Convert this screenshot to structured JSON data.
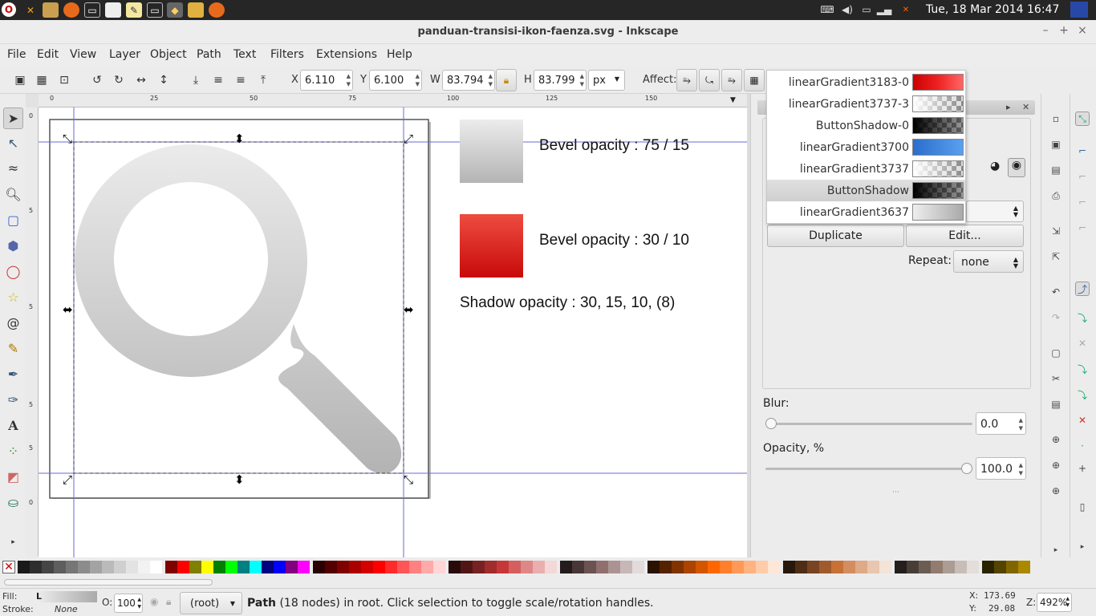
{
  "system": {
    "clock": "Tue, 18 Mar 2014 16:47",
    "tray_icons": [
      "keyboard-icon",
      "volume-icon",
      "battery-icon",
      "signal-icon",
      "network-icon"
    ],
    "launcher_icons": [
      "app-menu-icon",
      "tools-icon",
      "files-icon",
      "firefox-icon",
      "terminal-icon",
      "window-icon",
      "notes-icon",
      "terminal2-icon",
      "inkscape-icon",
      "folder-icon",
      "firefox2-icon"
    ]
  },
  "window": {
    "title": "panduan-transisi-ikon-faenza.svg - Inkscape",
    "minimize": "–",
    "maximize": "+",
    "close": "×"
  },
  "menu": [
    "File",
    "Edit",
    "View",
    "Layer",
    "Object",
    "Path",
    "Text",
    "Filters",
    "Extensions",
    "Help"
  ],
  "toolbar": {
    "x_label": "X",
    "x_value": "6.110",
    "y_label": "Y",
    "y_value": "6.100",
    "w_label": "W",
    "w_value": "83.794",
    "h_label": "H",
    "h_value": "83.799",
    "unit": "px",
    "affect_label": "Affect:"
  },
  "ruler": {
    "h_ticks": [
      "0",
      "25",
      "50",
      "75",
      "100",
      "125",
      "150"
    ],
    "v_ticks": [
      "0",
      "5",
      "5",
      "5",
      "5",
      "0"
    ]
  },
  "canvas": {
    "labels": [
      "Bevel opacity : 75 / 15",
      "Bevel opacity : 30 / 10",
      "Shadow opacity : 30, 15, 10, (8)"
    ],
    "colors": {
      "bevel1_top": "#ececec",
      "bevel1_bottom": "#b4b4b4",
      "bevel2_top": "#ee4c40",
      "bevel2_bottom": "#c80a0a",
      "icon_top": "#ebebec",
      "icon_bottom": "#b3b3b3"
    }
  },
  "gradients": [
    {
      "name": "linearGradient3183-0",
      "swatch": "red"
    },
    {
      "name": "linearGradient3737-3",
      "swatch": "fade-checker"
    },
    {
      "name": "ButtonShadow-0",
      "swatch": "black-checker"
    },
    {
      "name": "linearGradient3700",
      "swatch": "blue"
    },
    {
      "name": "linearGradient3737",
      "swatch": "fade-checker"
    },
    {
      "name": "ButtonShadow",
      "swatch": "black-checker",
      "selected": true
    },
    {
      "name": "linearGradient3637",
      "swatch": "gray"
    }
  ],
  "panel": {
    "duplicate_label": "Duplicate",
    "edit_label": "Edit...",
    "repeat_label": "Repeat:",
    "repeat_value": "none",
    "blur_label": "Blur:",
    "blur_value": "0.0",
    "blur_level": 0,
    "opacity_label": "Opacity, %",
    "opacity_value": "100.0",
    "opacity_level": 100
  },
  "status": {
    "fill_label": "Fill:",
    "fill_value": "L",
    "stroke_label": "Stroke:",
    "stroke_value": "None",
    "o_label": "O:",
    "o_value": "100",
    "layer": "(root)",
    "message_bold": "Path",
    "message": " (18 nodes) in root. Click selection to toggle scale/rotation handles.",
    "x_label": "X:",
    "x_value": "173.69",
    "y_label": "Y:",
    "y_value": "29.08",
    "z_label": "Z:",
    "zoom": "492%"
  },
  "palette": [
    "#1a1a1a",
    "#2e2e2e",
    "#454545",
    "#5e5e5e",
    "#767676",
    "#8c8c8c",
    "#a3a3a3",
    "#bababa",
    "#cfcfcf",
    "#e3e3e3",
    "#f2f2f2",
    "#ffffff",
    "#800000",
    "#ff0000",
    "#808000",
    "#ffff00",
    "#008000",
    "#00ff00",
    "#008080",
    "#00ffff",
    "#000080",
    "#0000ff",
    "#800080",
    "#ff00ff",
    "#2b0000",
    "#550000",
    "#800000",
    "#aa0000",
    "#d40000",
    "#ff0000",
    "#ff2a2a",
    "#ff5555",
    "#ff8080",
    "#ffaaaa",
    "#ffd5d5",
    "#280b0b",
    "#501616",
    "#782121",
    "#a02c2c",
    "#c83737",
    "#d35f5f",
    "#de8787",
    "#e9afaf",
    "#f4d7d7",
    "#241c1c",
    "#483737",
    "#6c5353",
    "#916f6f",
    "#ac9393",
    "#c8b7b7",
    "#e3dbdb",
    "#2b1100",
    "#552200",
    "#803300",
    "#aa4400",
    "#d45500",
    "#ff6600",
    "#ff7f2a",
    "#ff9955",
    "#ffb380",
    "#ffccaa",
    "#ffe6d5",
    "#28170b",
    "#502d16",
    "#784421",
    "#a05a2c",
    "#c87137",
    "#d38d5f",
    "#deaa87",
    "#e9c6af",
    "#f4e3d7",
    "#241f1c",
    "#483e37",
    "#6c5d53",
    "#917c6f",
    "#ac9d93",
    "#c8beb7",
    "#e3dedb",
    "#2b2200",
    "#554400",
    "#806600",
    "#aa8800"
  ]
}
